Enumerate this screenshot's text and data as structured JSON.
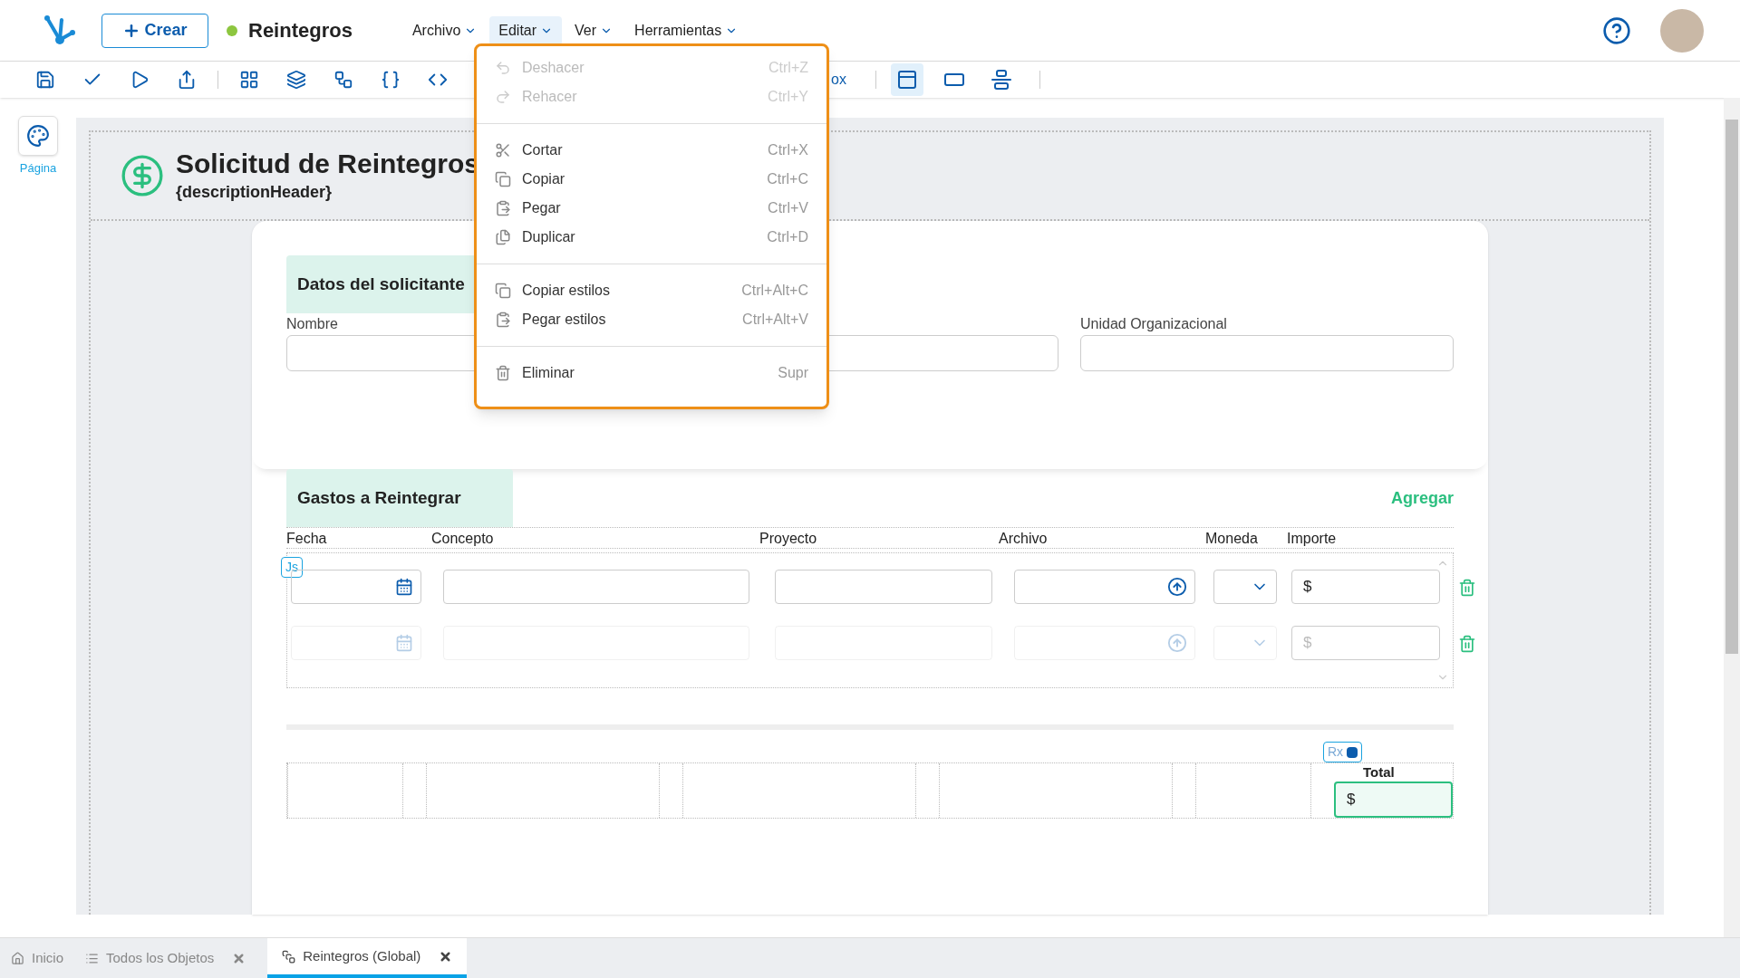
{
  "app": {
    "create_button": "Crear",
    "document": {
      "name": "Reintegros"
    }
  },
  "menus": [
    {
      "label": "Archivo",
      "selected": false
    },
    {
      "label": "Editar",
      "selected": true
    },
    {
      "label": "Ver",
      "selected": false
    },
    {
      "label": "Herramientas",
      "selected": false
    }
  ],
  "toolbar": {
    "partial_label": "ox",
    "view_toggles": [
      {
        "kind": "layout",
        "selected": true
      },
      {
        "kind": "window",
        "selected": false
      },
      {
        "kind": "align",
        "selected": false
      }
    ]
  },
  "side_panel": {
    "label": "Página"
  },
  "page": {
    "title": "Solicitud de Reintegros",
    "subtitle": "{descriptionHeader}"
  },
  "section1": {
    "title": "Datos del solicitante",
    "fields": [
      {
        "kind": "labeled",
        "label": "Nombre"
      },
      {
        "kind": "unlabeled"
      },
      {
        "kind": "labeled",
        "label": "Unidad Organizacional"
      }
    ]
  },
  "section2": {
    "title": "Gastos a Reintegrar",
    "add_link": "Agregar",
    "script_badge": "Js",
    "columns": [
      "Fecha",
      "Concepto",
      "Proyecto",
      "Archivo",
      "Moneda",
      "Importe"
    ],
    "rows": [
      {
        "disabled": false,
        "currency": "$"
      },
      {
        "disabled": true,
        "currency": "$"
      }
    ]
  },
  "totals": {
    "label": "Total",
    "value": "$",
    "badge": "Rx"
  },
  "edit_menu": {
    "groups": [
      {
        "items": [
          {
            "kind": "undo",
            "label": "Deshacer",
            "shortcut": "Ctrl+Z",
            "disabled": true
          },
          {
            "kind": "redo",
            "label": "Rehacer",
            "shortcut": "Ctrl+Y",
            "disabled": true
          }
        ]
      },
      {
        "items": [
          {
            "kind": "cut",
            "label": "Cortar",
            "shortcut": "Ctrl+X",
            "disabled": false
          },
          {
            "kind": "copy",
            "label": "Copiar",
            "shortcut": "Ctrl+C",
            "disabled": false
          },
          {
            "kind": "paste",
            "label": "Pegar",
            "shortcut": "Ctrl+V",
            "disabled": false
          },
          {
            "kind": "duplicate",
            "label": "Duplicar",
            "shortcut": "Ctrl+D",
            "disabled": false
          }
        ]
      },
      {
        "items": [
          {
            "kind": "copy",
            "label": "Copiar estilos",
            "shortcut": "Ctrl+Alt+C",
            "disabled": false
          },
          {
            "kind": "paste",
            "label": "Pegar estilos",
            "shortcut": "Ctrl+Alt+V",
            "disabled": false
          }
        ]
      },
      {
        "items": [
          {
            "kind": "delete",
            "label": "Eliminar",
            "shortcut": "Supr",
            "disabled": false
          }
        ]
      }
    ]
  },
  "bottom_tabs": [
    {
      "kind": "home",
      "label": "Inicio",
      "closable": false,
      "selected": false
    },
    {
      "kind": "list",
      "label": "Todos los Objetos",
      "closable": true,
      "selected": false
    },
    {
      "kind": "form",
      "label": "Reintegros (Global)",
      "closable": true,
      "selected": true
    }
  ]
}
